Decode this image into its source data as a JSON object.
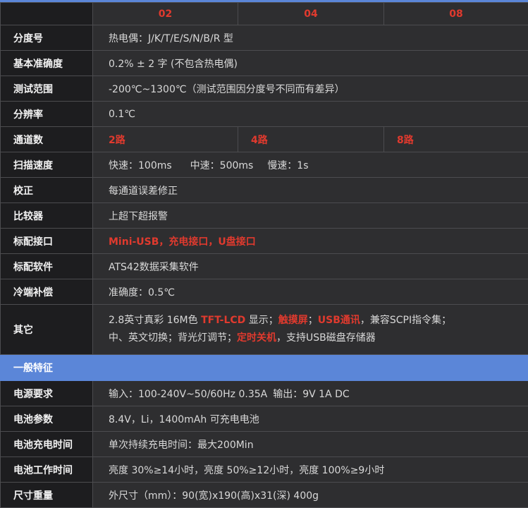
{
  "header": {
    "cols": [
      "02",
      "04",
      "08"
    ]
  },
  "rows": {
    "fendu": {
      "label": "分度号",
      "value": "热电偶：J/K/T/E/S/N/B/R 型"
    },
    "accuracy": {
      "label": "基本准确度",
      "value": "0.2% ± 2 字 (不包含热电偶)"
    },
    "range": {
      "label": "测试范围",
      "value": "-200℃~1300℃（测试范围因分度号不同而有差异）"
    },
    "resolution": {
      "label": "分辨率",
      "value": "0.1℃"
    },
    "channels": {
      "label": "通道数",
      "values": [
        "2路",
        "4路",
        "8路"
      ]
    },
    "scan": {
      "label": "扫描速度",
      "fast": "快速：100ms",
      "mid": "中速：500ms",
      "slow": "慢速：1s"
    },
    "calib": {
      "label": "校正",
      "value": "每通道误差修正"
    },
    "compare": {
      "label": "比较器",
      "value": "上超下超报警"
    },
    "iface": {
      "label": "标配接口",
      "value": "Mini-USB，充电接口，U盘接口"
    },
    "software": {
      "label": "标配软件",
      "value": "ATS42数据采集软件"
    },
    "cold": {
      "label": "冷端补偿",
      "value": "准确度：0.5℃"
    },
    "other": {
      "label": "其它",
      "l1_a": "2.8英寸真彩 16M色 ",
      "l1_b": "TFT-LCD",
      "l1_c": " 显示；",
      "l1_d": "触摸屏",
      "l1_e": "；",
      "l1_f": "USB通讯",
      "l1_g": "，兼容SCPI指令集；",
      "l2_a": "中、英文切换；背光灯调节；",
      "l2_b": "定时关机",
      "l2_c": "，支持USB磁盘存储器"
    }
  },
  "section": {
    "title": "一般特征"
  },
  "general": {
    "power": {
      "label": "电源要求",
      "input": "输入：100-240V~50/60Hz 0.35A",
      "output": "输出：9V 1A DC"
    },
    "battery": {
      "label": "电池参数",
      "value": "8.4V，Li，1400mAh 可充电电池"
    },
    "charge": {
      "label": "电池充电时间",
      "value": "单次持续充电时间：最大200Min"
    },
    "work": {
      "label": "电池工作时间",
      "value": "亮度 30%≥14小时，亮度 50%≥12小时，亮度 100%≥9小时"
    },
    "size": {
      "label": "尺寸重量",
      "value": "外尺寸（mm）：90(宽)x190(高)x31(深)  400g"
    }
  },
  "colors": {
    "accent_red": "#e03a2e",
    "section_blue": "#5b86d8",
    "label_bg": "#1d1d1f",
    "value_bg": "#2e2e30"
  }
}
